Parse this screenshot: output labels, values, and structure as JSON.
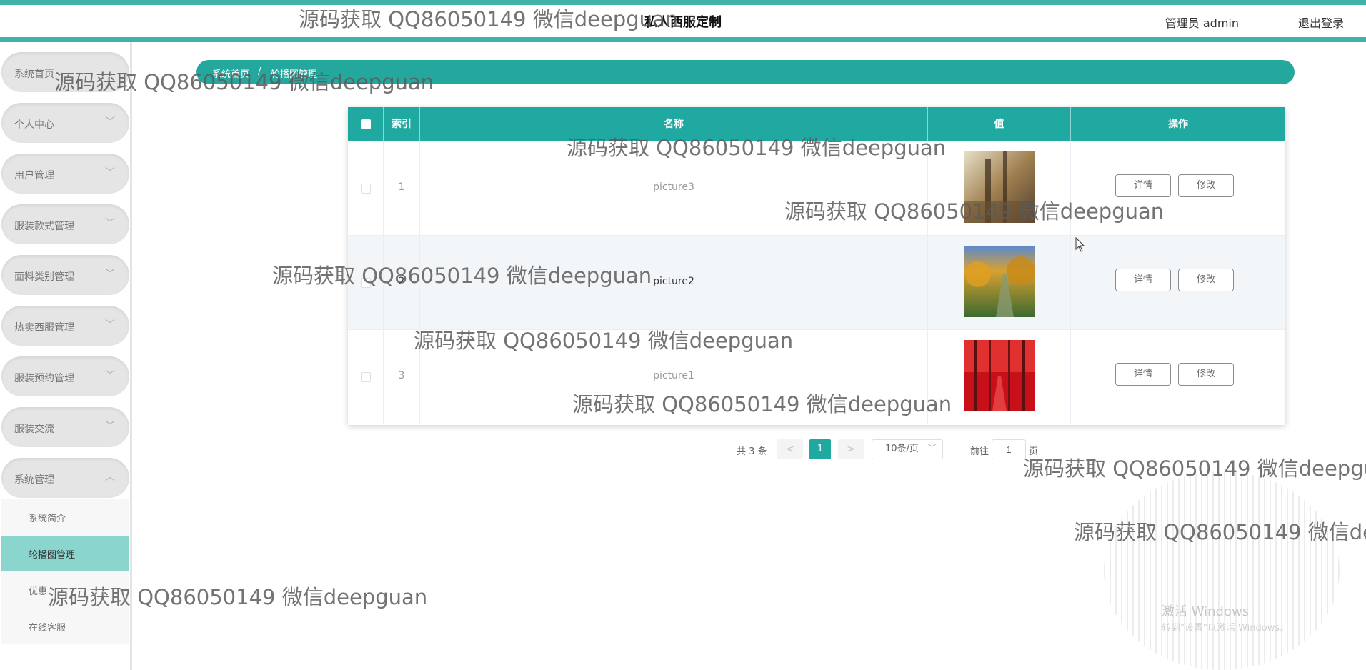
{
  "header": {
    "title": "私人西服定制",
    "admin_label": "管理员 admin",
    "logout_label": "退出登录"
  },
  "sidebar": {
    "items": [
      {
        "label": "系统首页",
        "has_chevron": false
      },
      {
        "label": "个人中心",
        "has_chevron": true
      },
      {
        "label": "用户管理",
        "has_chevron": true
      },
      {
        "label": "服装款式管理",
        "has_chevron": true
      },
      {
        "label": "面料类别管理",
        "has_chevron": true
      },
      {
        "label": "热卖西服管理",
        "has_chevron": true
      },
      {
        "label": "服装预约管理",
        "has_chevron": true
      },
      {
        "label": "服装交流",
        "has_chevron": true
      },
      {
        "label": "系统管理",
        "has_chevron": true,
        "expanded": true
      }
    ],
    "subitems": [
      {
        "label": "系统简介",
        "active": false
      },
      {
        "label": "轮播图管理",
        "active": true
      },
      {
        "label": "优惠",
        "active": false
      },
      {
        "label": "在线客服",
        "active": false
      }
    ]
  },
  "breadcrumb": {
    "home": "系统首页",
    "separator": "/",
    "current": "轮播图管理"
  },
  "table": {
    "columns": [
      "索引",
      "名称",
      "值",
      "操作"
    ],
    "rows": [
      {
        "index": "1",
        "name": "picture3",
        "thumb": "autumn-trees-sepia"
      },
      {
        "index": "2",
        "name": "picture2",
        "thumb": "autumn-forest-path"
      },
      {
        "index": "3",
        "name": "picture1",
        "thumb": "red-trees-path"
      }
    ],
    "detail_label": "详情",
    "edit_label": "修改"
  },
  "pagination": {
    "total": "共 3 条",
    "prev": "<",
    "next": ">",
    "current_page": "1",
    "page_size": "10条/页",
    "goto_label": "前往",
    "goto_value": "1",
    "page_label": "页"
  },
  "watermark_text": "源码获取 QQ86050149 微信deepguan",
  "os_overlay": {
    "line1": "激活 Windows",
    "line2": "转到\"设置\"以激活 Windows。"
  },
  "colors": {
    "accent": "#1fa9a0",
    "accent_light": "#8ad5cd",
    "breadcrumb_bg": "#24a89e"
  }
}
